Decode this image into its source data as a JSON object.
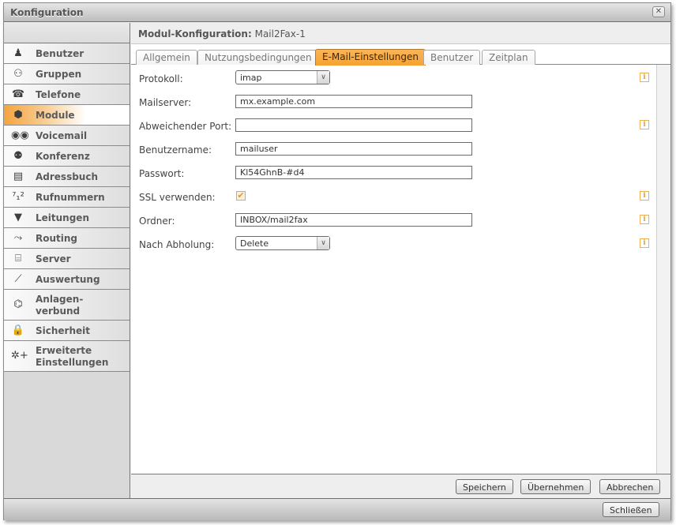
{
  "window": {
    "title": "Konfiguration",
    "close_icon": "close-x-icon"
  },
  "sidebar": {
    "items": [
      {
        "label": "Benutzer",
        "icon": "user-icon",
        "glyph": "♟",
        "active": false
      },
      {
        "label": "Gruppen",
        "icon": "group-icon",
        "glyph": "⚇",
        "active": false
      },
      {
        "label": "Telefone",
        "icon": "phone-icon",
        "glyph": "☎",
        "active": false
      },
      {
        "label": "Module",
        "icon": "module-box-icon",
        "glyph": "⬢",
        "active": true
      },
      {
        "label": "Voicemail",
        "icon": "voicemail-icon",
        "glyph": "◉◉",
        "active": false
      },
      {
        "label": "Konferenz",
        "icon": "conference-icon",
        "glyph": "⚉",
        "active": false
      },
      {
        "label": "Adressbuch",
        "icon": "address-book-icon",
        "glyph": "▤",
        "active": false
      },
      {
        "label": "Rufnummern",
        "icon": "numbers-icon",
        "glyph": "⁷₁²",
        "active": false
      },
      {
        "label": "Leitungen",
        "icon": "trunk-plug-icon",
        "glyph": "▼",
        "active": false
      },
      {
        "label": "Routing",
        "icon": "routing-icon",
        "glyph": "⤳",
        "active": false
      },
      {
        "label": "Server",
        "icon": "server-icon",
        "glyph": "⌸",
        "active": false
      },
      {
        "label": "Auswertung",
        "icon": "chart-icon",
        "glyph": "⟋",
        "active": false
      },
      {
        "label": "Anlagen-\nverbund",
        "icon": "network-icon",
        "glyph": "⌬",
        "active": false
      },
      {
        "label": "Sicherheit",
        "icon": "lock-icon",
        "glyph": "🔒",
        "active": false
      },
      {
        "label": "Erweiterte\nEinstellungen",
        "icon": "advanced-settings-icon",
        "glyph": "✲+",
        "active": false
      }
    ]
  },
  "main": {
    "heading_label": "Modul-Konfiguration:",
    "heading_value": "Mail2Fax-1",
    "tabs": [
      {
        "label": "Allgemein",
        "active": false
      },
      {
        "label": "Nutzungsbedingungen",
        "active": false
      },
      {
        "label": "E-Mail-Einstellungen",
        "active": true
      },
      {
        "label": "Benutzer",
        "active": false
      },
      {
        "label": "Zeitplan",
        "active": false
      }
    ],
    "fields": {
      "protocol": {
        "label": "Protokoll:",
        "value": "imap"
      },
      "mailserver": {
        "label": "Mailserver:",
        "value": "mx.example.com"
      },
      "port": {
        "label": "Abweichender Port:",
        "value": ""
      },
      "username": {
        "label": "Benutzername:",
        "value": "mailuser"
      },
      "password": {
        "label": "Passwort:",
        "value": "Kl54GhnB-#d4"
      },
      "ssl": {
        "label": "SSL verwenden:",
        "checked": true,
        "check_glyph": "✔"
      },
      "folder": {
        "label": "Ordner:",
        "value": "INBOX/mail2fax"
      },
      "after_fetch": {
        "label": "Nach Abholung:",
        "value": "Delete"
      }
    },
    "info_glyph": "i",
    "select_arrow": "∨",
    "buttons": {
      "save": "Speichern",
      "apply": "Übernehmen",
      "cancel": "Abbrechen"
    }
  },
  "footer": {
    "close_label": "Schließen"
  }
}
